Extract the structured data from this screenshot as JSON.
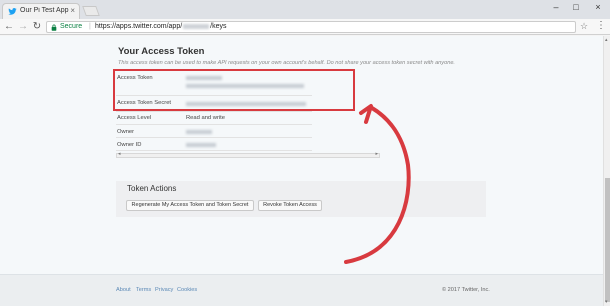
{
  "browser": {
    "tab_title": "Our Pi Test App | Twitter",
    "close_glyph": "×",
    "secure_label": "Secure",
    "url_prefix": "https://apps.twitter.com/app/",
    "url_suffix": "/keys",
    "window_controls": {
      "minimize": "–",
      "maximize": "□",
      "close": "×"
    },
    "nav": {
      "back": "←",
      "forward": "→",
      "reload": "↻"
    },
    "star": "☆",
    "menu": "⋮"
  },
  "access_token": {
    "title": "Your Access Token",
    "subtitle": "This access token can be used to make API requests on your own account's behalf. Do not share your access token secret with anyone.",
    "rows": [
      {
        "label": "Access Token",
        "value": ""
      },
      {
        "label": "Access Token Secret",
        "value": ""
      },
      {
        "label": "Access Level",
        "value": "Read and write"
      },
      {
        "label": "Owner",
        "value": ""
      },
      {
        "label": "Owner ID",
        "value": ""
      }
    ]
  },
  "token_actions": {
    "title": "Token Actions",
    "regenerate_label": "Regenerate My Access Token and Token Secret",
    "revoke_label": "Revoke Token Access"
  },
  "footer": {
    "links": [
      "About",
      "Terms",
      "Privacy",
      "Cookies"
    ],
    "copyright": "© 2017 Twitter, Inc."
  },
  "colors": {
    "annotation": "#d83a3f",
    "link": "#5b89b6",
    "twitter_blue": "#1da1f2",
    "secure_green": "#0b8043"
  },
  "icons": [
    "twitter-bird-icon",
    "lock-icon",
    "star-icon",
    "menu-icon",
    "back-icon",
    "forward-icon",
    "reload-icon",
    "curved-arrow-annotation"
  ]
}
